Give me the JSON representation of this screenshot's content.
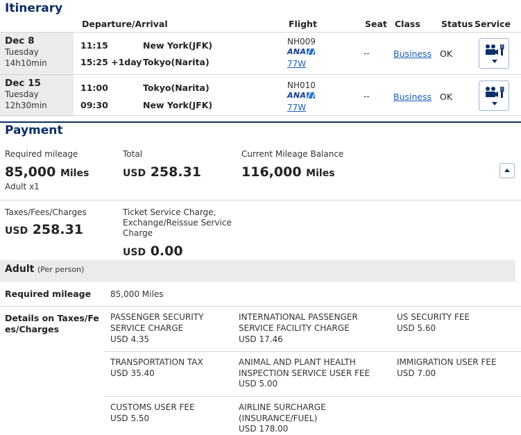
{
  "itinerary": {
    "title": "Itinerary",
    "headers": {
      "dep_arr": "Departure/Arrival",
      "flight": "Flight",
      "seat": "Seat",
      "class": "Class",
      "status": "Status",
      "service": "Service"
    },
    "segments": [
      {
        "date": "Dec 8",
        "weekday": "Tuesday",
        "duration": "14h10min",
        "dep_time": "11:15",
        "dep_city": "New York(JFK)",
        "arr_time": "15:25 +1day",
        "arr_city": "Tokyo(Narita)",
        "flight_no": "NH009",
        "airline": "ANA",
        "aircraft": "77W",
        "seat": "--",
        "class": "Business",
        "status": "OK"
      },
      {
        "date": "Dec 15",
        "weekday": "Tuesday",
        "duration": "12h30min",
        "dep_time": "11:00",
        "dep_city": "Tokyo(Narita)",
        "arr_time": "09:30",
        "arr_city": "New York(JFK)",
        "flight_no": "NH010",
        "airline": "ANA",
        "aircraft": "77W",
        "seat": "--",
        "class": "Business",
        "status": "OK"
      }
    ]
  },
  "payment": {
    "title": "Payment",
    "required_mileage_label": "Required mileage",
    "required_mileage_value": "85,000",
    "required_mileage_unit": "Miles",
    "adult_count": "Adult x1",
    "total_label": "Total",
    "total_currency": "USD",
    "total_value": "258.31",
    "balance_label": "Current Mileage Balance",
    "balance_value": "116,000",
    "balance_unit": "Miles",
    "taxes_label": "Taxes/Fees/Charges",
    "taxes_currency": "USD",
    "taxes_value": "258.31",
    "ticket_service_label": "Ticket Service Charge, Exchange/Reissue Service Charge",
    "ticket_service_currency": "USD",
    "ticket_service_value": "0.00"
  },
  "adult": {
    "title": "Adult",
    "subtitle": "(Per person)",
    "required_mileage_label": "Required mileage",
    "required_mileage_value": "85,000 Miles",
    "details_label": "Details on Taxes/Fees/Charges",
    "fees": [
      {
        "name": "PASSENGER SECURITY SERVICE CHARGE",
        "amount": "USD 4.35"
      },
      {
        "name": "INTERNATIONAL PASSENGER SERVICE FACILITY CHARGE",
        "amount": "USD 17.46"
      },
      {
        "name": "US SECURITY FEE",
        "amount": "USD 5.60"
      },
      {
        "name": "TRANSPORTATION TAX",
        "amount": "USD 35.40"
      },
      {
        "name": "ANIMAL AND PLANT HEALTH INSPECTION SERVICE USER FEE",
        "amount": "USD 5.00"
      },
      {
        "name": "IMMIGRATION USER FEE",
        "amount": "USD 7.00"
      },
      {
        "name": "CUSTOMS USER FEE",
        "amount": "USD 5.50"
      },
      {
        "name": "AIRLINE SURCHARGE (INSURANCE/FUEL)",
        "amount": "USD 178.00"
      }
    ]
  },
  "icons": {
    "service": "in-flight-service-icon",
    "dropdown": "chevron-down-icon",
    "collapse": "chevron-up-icon"
  },
  "colors": {
    "heading": "#0b2f66",
    "link": "#1a5cb8",
    "date_bg": "#ececec",
    "adult_bg": "#ebebeb"
  }
}
